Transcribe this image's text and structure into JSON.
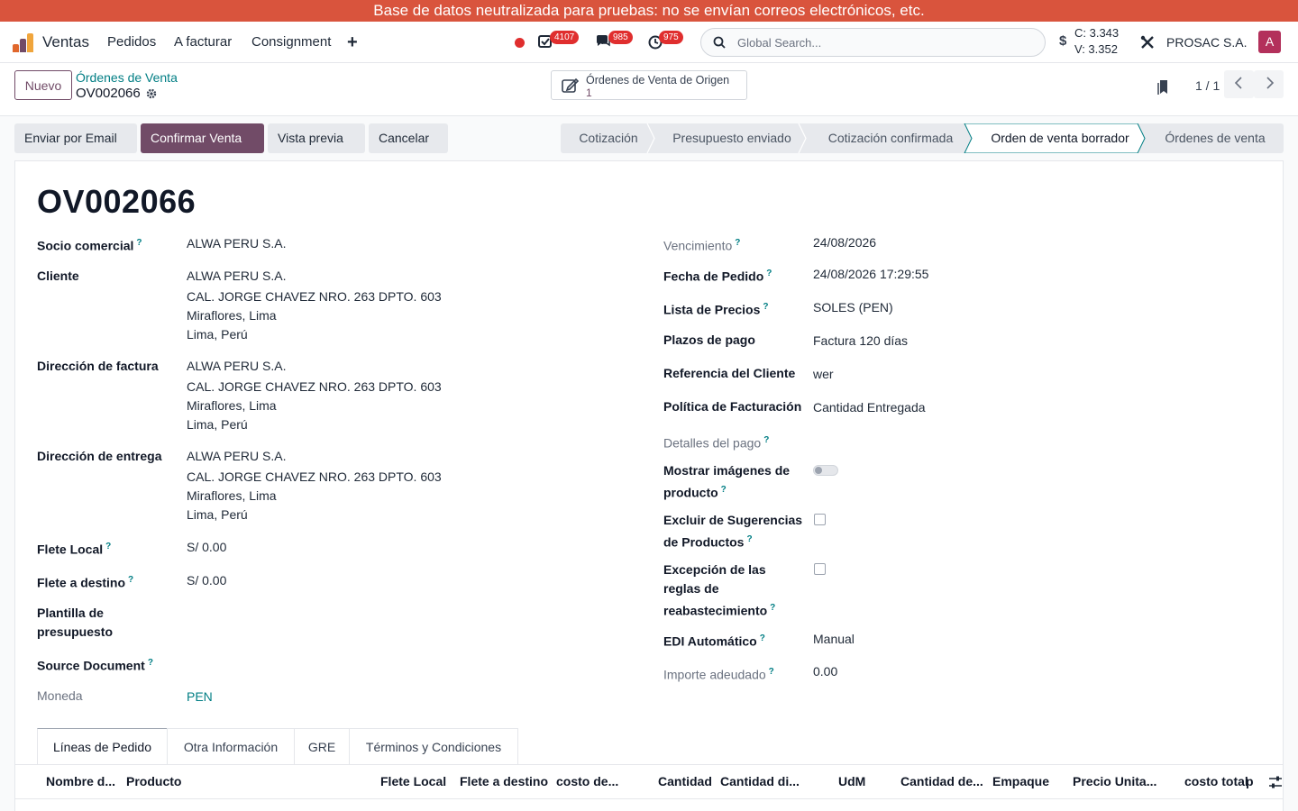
{
  "banner": "Base de datos neutralizada para pruebas: no se envían correos electrónicos, etc.",
  "nav": {
    "app": "Ventas",
    "menus": [
      "Pedidos",
      "A facturar",
      "Consignment"
    ],
    "plus": "+",
    "badges": {
      "activities": "4107",
      "messages": "985",
      "timer": "975"
    },
    "search_placeholder": "Global Search...",
    "currency_symbol": "$",
    "rate_c": "C: 3.343",
    "rate_v": "V: 3.352",
    "company": "PROSAC S.A.",
    "avatar_letter": "A",
    "colors": {
      "primary": "#714b67",
      "link": "#017e84",
      "banner": "#d9543d",
      "badge": "#e02e2e"
    }
  },
  "control": {
    "new_label": "Nuevo",
    "breadcrumb_parent": "Órdenes de Venta",
    "breadcrumb_current": "OV002066",
    "smart_label": "Órdenes de Venta de Origen",
    "smart_count": "1",
    "pager": "1 / 1"
  },
  "actions": [
    "Enviar por Email",
    "Confirmar Venta",
    "Vista previa",
    "Cancelar"
  ],
  "stages": [
    "Cotización",
    "Presupuesto enviado",
    "Cotización confirmada",
    "Orden de venta borrador",
    "Órdenes de venta"
  ],
  "form": {
    "title": "OV002066",
    "left": {
      "socio_label": "Socio comercial",
      "socio": "ALWA PERU S.A.",
      "cliente_label": "Cliente",
      "cliente": [
        "ALWA PERU S.A.",
        "CAL. JORGE CHAVEZ NRO. 263 DPTO. 603",
        "Miraflores, Lima",
        "Lima, Perú"
      ],
      "factura_label": "Dirección de factura",
      "factura": [
        "ALWA PERU S.A.",
        "CAL. JORGE CHAVEZ NRO. 263 DPTO. 603",
        "Miraflores, Lima",
        "Lima, Perú"
      ],
      "entrega_label": "Dirección de entrega",
      "entrega": [
        "ALWA PERU S.A.",
        "CAL. JORGE CHAVEZ NRO. 263 DPTO. 603",
        "Miraflores, Lima",
        "Lima, Perú"
      ],
      "flete_local_label": "Flete Local",
      "flete_local": "S/ 0.00",
      "flete_destino_label": "Flete a destino",
      "flete_destino": "S/ 0.00",
      "plantilla_label_1": "Plantilla de",
      "plantilla_label_2": "presupuesto",
      "source_label": "Source Document",
      "moneda_label": "Moneda",
      "moneda": "PEN"
    },
    "right": {
      "vencimiento_label": "Vencimiento",
      "vencimiento": "24/08/2026",
      "fecha_label": "Fecha de Pedido",
      "fecha": "24/08/2026 17:29:55",
      "lista_label": "Lista de Precios",
      "lista": "SOLES (PEN)",
      "plazos_label": "Plazos de pago",
      "plazos": "Factura 120 días",
      "ref_label": "Referencia del Cliente",
      "ref": "wer",
      "politica_label": "Política de Facturación",
      "politica": "Cantidad Entregada",
      "detalles_label": "Detalles del pago",
      "mostrar_label_1": "Mostrar imágenes de",
      "mostrar_label_2": "producto",
      "excluir_label_1": "Excluir de Sugerencias",
      "excluir_label_2": "de Productos",
      "excepcion_label_1": "Excepción de las",
      "excepcion_label_2": "reglas de",
      "excepcion_label_3": "reabastecimiento",
      "edi_label": "EDI Automático",
      "edi": "Manual",
      "importe_label": "Importe adeudado",
      "importe": "0.00"
    },
    "help_mark": "?"
  },
  "tabs": [
    "Líneas de Pedido",
    "Otra Información",
    "GRE",
    "Términos y Condiciones"
  ],
  "columns": [
    "Nombre d...",
    "Producto",
    "Flete Local",
    "Flete a destino",
    "costo de...",
    "Cantidad",
    "Cantidad di...",
    "UdM",
    "Cantidad de...",
    "Empaque",
    "Precio Unita...",
    "costo total",
    "p"
  ]
}
